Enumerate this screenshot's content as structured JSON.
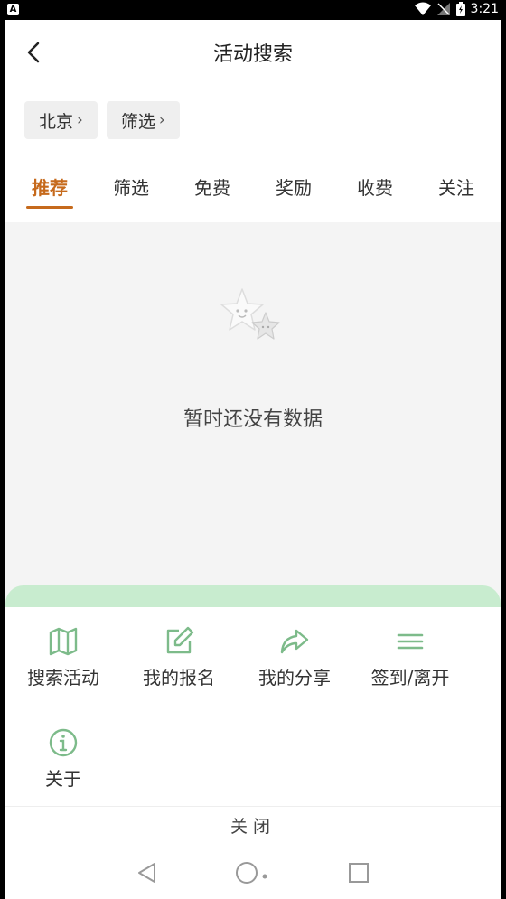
{
  "status_bar": {
    "left_badge": "A",
    "time": "3:21"
  },
  "header": {
    "title": "活动搜索"
  },
  "chips": [
    {
      "label": "北京",
      "chevron": "›"
    },
    {
      "label": "筛选",
      "chevron": "›"
    }
  ],
  "tabs": [
    {
      "label": "推荐",
      "active": true
    },
    {
      "label": "筛选"
    },
    {
      "label": "免费"
    },
    {
      "label": "奖励"
    },
    {
      "label": "收费"
    },
    {
      "label": "关注"
    }
  ],
  "empty_state": {
    "text": "暂时还没有数据"
  },
  "menu": {
    "items": [
      {
        "label": "搜索活动",
        "icon": "map-icon"
      },
      {
        "label": "我的报名",
        "icon": "edit-icon"
      },
      {
        "label": "我的分享",
        "icon": "share-icon"
      },
      {
        "label": "签到/离开",
        "icon": "menu-lines-icon"
      },
      {
        "label": "关于",
        "icon": "info-icon"
      }
    ],
    "close_label": "关闭"
  },
  "colors": {
    "accent": "#c66a1c",
    "icon_green": "#7dbb8a",
    "strip_green": "#c8eccf"
  }
}
